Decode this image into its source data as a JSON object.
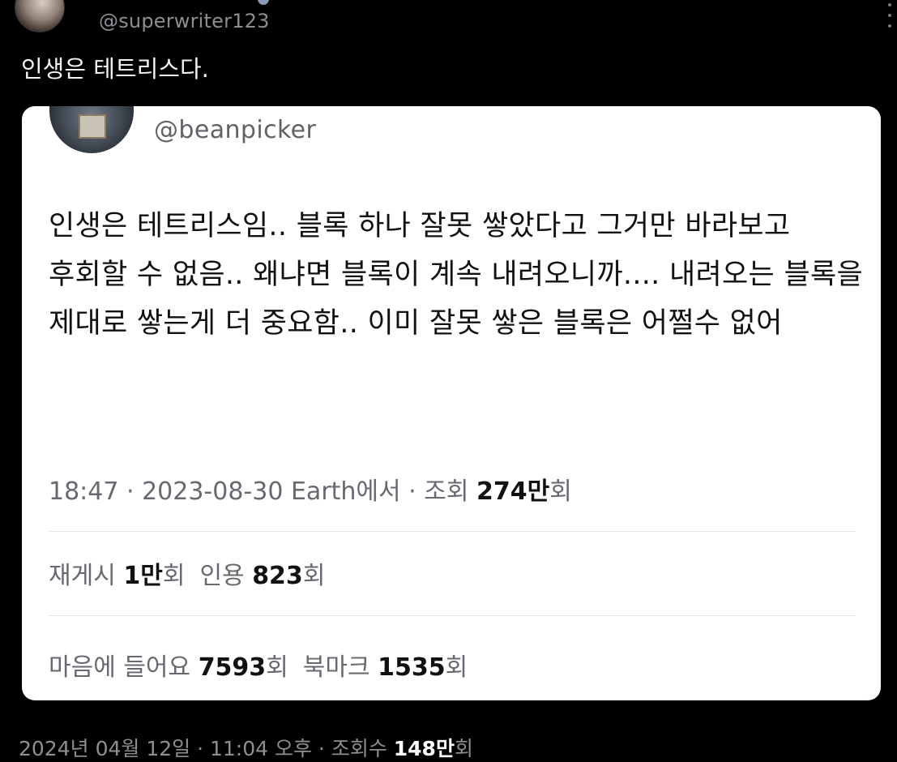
{
  "tweet": {
    "author_handle": "@superwriter123",
    "text": "인생은 테트리스다.",
    "bottom_meta": {
      "date_time": "2024년 04월 12일 · 11:04 오후 · 조회수 ",
      "views_value": "148만",
      "views_suffix": "회"
    }
  },
  "quote": {
    "author_handle": "@beanpicker",
    "body": "인생은 테트리스임.. 블록 하나 잘못 쌓았다고 그거만 바라보고 후회할 수 없음.. 왜냐면 블록이 계속 내려오니까.... 내려오는 블록을 제대로 쌓는게 더 중요함.. 이미 잘못 쌓은 블록은 어쩔수 없어",
    "meta": {
      "time": "18:47",
      "separator": " · ",
      "date": "2023-08-30",
      "source": " Earth에서",
      "views_label": "조회 ",
      "views_value": "274만",
      "views_suffix": "회"
    },
    "stats": {
      "reposts_label": "재게시 ",
      "reposts_value": "1만",
      "reposts_suffix": "회",
      "quotes_label": "인용 ",
      "quotes_value": "823",
      "quotes_suffix": "회",
      "likes_label": "마음에 들어요 ",
      "likes_value": "7593",
      "likes_suffix": "회",
      "bookmarks_label": "북마크 ",
      "bookmarks_value": "1535",
      "bookmarks_suffix": "회"
    }
  },
  "icons": {
    "more": "more-icon",
    "verified": "verified-badge-icon"
  },
  "colors": {
    "background": "#000000",
    "card": "#ffffff",
    "text_primary": "#111111",
    "text_secondary": "#666a70"
  }
}
